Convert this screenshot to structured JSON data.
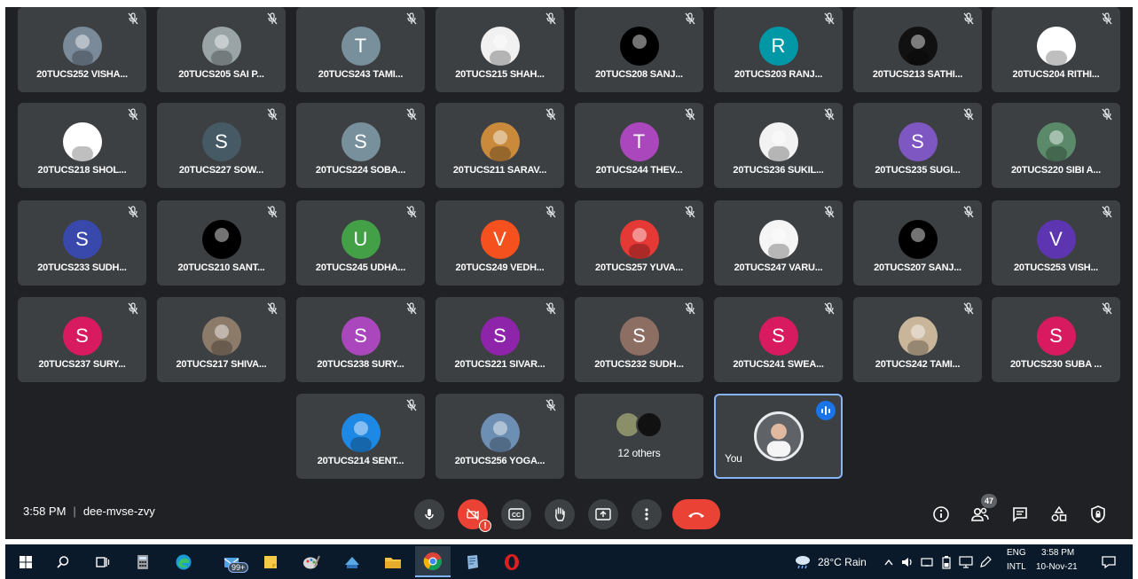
{
  "participants": [
    {
      "name": "20TUCS252 VISHA...",
      "avatar": "photo",
      "color": "#7a8a99"
    },
    {
      "name": "20TUCS205 SAI P...",
      "avatar": "photo",
      "color": "#9aa4a6"
    },
    {
      "name": "20TUCS243 TAMI...",
      "avatar": "letter",
      "initial": "T",
      "color": "#78909c"
    },
    {
      "name": "20TUCS215 SHAH...",
      "avatar": "photo",
      "color": "#f1f1f1"
    },
    {
      "name": "20TUCS208 SANJ...",
      "avatar": "photo",
      "color": "#000000"
    },
    {
      "name": "20TUCS203 RANJ...",
      "avatar": "letter",
      "initial": "R",
      "color": "#0097a7"
    },
    {
      "name": "20TUCS213 SATHI...",
      "avatar": "photo",
      "color": "#111111"
    },
    {
      "name": "20TUCS204 RITHI...",
      "avatar": "photo",
      "color": "#ffffff"
    },
    {
      "name": "20TUCS218 SHOL...",
      "avatar": "photo",
      "color": "#ffffff"
    },
    {
      "name": "20TUCS227 SOW...",
      "avatar": "letter",
      "initial": "S",
      "color": "#455a64"
    },
    {
      "name": "20TUCS224 SOBA...",
      "avatar": "letter",
      "initial": "S",
      "color": "#78909c"
    },
    {
      "name": "20TUCS211 SARAV...",
      "avatar": "photo",
      "color": "#c98a3c"
    },
    {
      "name": "20TUCS244 THEV...",
      "avatar": "letter",
      "initial": "T",
      "color": "#ab47bc"
    },
    {
      "name": "20TUCS236 SUKIL...",
      "avatar": "photo",
      "color": "#f2f2f2"
    },
    {
      "name": "20TUCS235 SUGI...",
      "avatar": "letter",
      "initial": "S",
      "color": "#7e57c2"
    },
    {
      "name": "20TUCS220 SIBI A...",
      "avatar": "photo",
      "color": "#5a8a6a"
    },
    {
      "name": "20TUCS233 SUDH...",
      "avatar": "letter",
      "initial": "S",
      "color": "#3949ab"
    },
    {
      "name": "20TUCS210 SANT...",
      "avatar": "photo",
      "color": "#000000"
    },
    {
      "name": "20TUCS245 UDHA...",
      "avatar": "letter",
      "initial": "U",
      "color": "#43a047"
    },
    {
      "name": "20TUCS249 VEDH...",
      "avatar": "letter",
      "initial": "V",
      "color": "#f4511e"
    },
    {
      "name": "20TUCS257 YUVA...",
      "avatar": "photo",
      "color": "#e53935"
    },
    {
      "name": "20TUCS247 VARU...",
      "avatar": "photo",
      "color": "#f5f5f5"
    },
    {
      "name": "20TUCS207 SANJ...",
      "avatar": "photo",
      "color": "#000000"
    },
    {
      "name": "20TUCS253 VISH...",
      "avatar": "letter",
      "initial": "V",
      "color": "#5e35b1"
    },
    {
      "name": "20TUCS237 SURY...",
      "avatar": "letter",
      "initial": "S",
      "color": "#d81b60"
    },
    {
      "name": "20TUCS217 SHIVA...",
      "avatar": "photo",
      "color": "#8d7b6a"
    },
    {
      "name": "20TUCS238 SURY...",
      "avatar": "letter",
      "initial": "S",
      "color": "#ab47bc"
    },
    {
      "name": "20TUCS221 SIVAR...",
      "avatar": "letter",
      "initial": "S",
      "color": "#8e24aa"
    },
    {
      "name": "20TUCS232 SUDH...",
      "avatar": "letter",
      "initial": "S",
      "color": "#8d6e63"
    },
    {
      "name": "20TUCS241 SWEA...",
      "avatar": "letter",
      "initial": "S",
      "color": "#d81b60"
    },
    {
      "name": "20TUCS242 TAMI...",
      "avatar": "photo",
      "color": "#c9b59a"
    },
    {
      "name": "20TUCS230 SUBA ...",
      "avatar": "letter",
      "initial": "S",
      "color": "#d81b60"
    },
    {
      "name": "20TUCS214 SENT...",
      "avatar": "photo",
      "color": "#1e88e5"
    },
    {
      "name": "20TUCS256 YOGA...",
      "avatar": "photo",
      "color": "#6d8fb3"
    }
  ],
  "others_tile": {
    "label": "12 others"
  },
  "self_tile": {
    "label": "You"
  },
  "meeting": {
    "time": "3:58 PM",
    "separator": "|",
    "code": "dee-mvse-zvy"
  },
  "controls": [
    {
      "icon": "mic-icon",
      "label": "microphone"
    },
    {
      "icon": "camera-off-icon",
      "label": "camera"
    },
    {
      "icon": "captions-icon",
      "label": "captions"
    },
    {
      "icon": "raise-hand-icon",
      "label": "raise hand"
    },
    {
      "icon": "present-icon",
      "label": "present now"
    },
    {
      "icon": "more-options-icon",
      "label": "more options"
    },
    {
      "icon": "hang-up-icon",
      "label": "leave call"
    }
  ],
  "right_controls": {
    "participant_count": "47"
  },
  "colors": {
    "meet_bg": "#202124",
    "tile_bg": "#3c4043",
    "hangup": "#ea4335",
    "speaking": "#1a73e8",
    "taskbar": "#0b1a2a"
  },
  "taskbar": {
    "notification_badge": "99+",
    "weather": "28°C Rain",
    "lang_top": "ENG",
    "lang_bottom": "INTL",
    "clock_time": "3:58 PM",
    "clock_date": "10-Nov-21"
  }
}
